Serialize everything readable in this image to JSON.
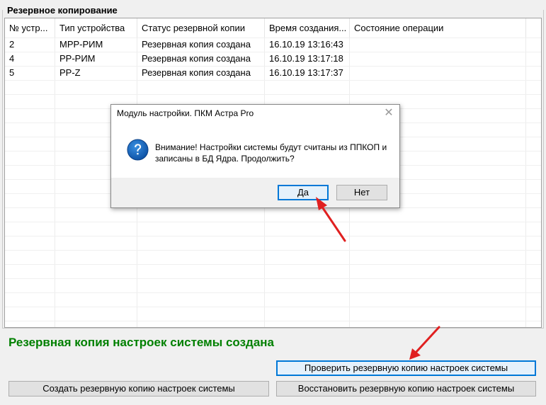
{
  "group_title": "Резервное копирование",
  "columns": [
    "№ устр...",
    "Тип устройства",
    "Статус резервной копии",
    "Время создания...",
    "Состояние операции"
  ],
  "rows": [
    {
      "num": "2",
      "type": "МРР-РИМ",
      "status": "Резервная копия создана",
      "time": "16.10.19 13:16:43",
      "state": ""
    },
    {
      "num": "4",
      "type": "РР-РИМ",
      "status": "Резервная копия создана",
      "time": "16.10.19 13:17:18",
      "state": ""
    },
    {
      "num": "5",
      "type": "РР-Z",
      "status": "Резервная копия создана",
      "time": "16.10.19 13:17:37",
      "state": ""
    }
  ],
  "status_message": "Резервная копия настроек системы создана",
  "status_color": "#008000",
  "buttons": {
    "check": "Проверить резервную копию настроек системы",
    "create": "Создать резервную копию настроек системы",
    "restore": "Восстановить резервную копию настроек системы"
  },
  "dialog": {
    "title": "Модуль настройки. ПКМ Астра Pro",
    "message_line1": "Внимание! Настройки системы будут считаны из ППКОП и",
    "message_line2": "записаны в БД Ядра. Продолжить?",
    "yes": "Да",
    "no": "Нет",
    "icon": "question-icon",
    "close_glyph": "✕"
  },
  "annotation_color": "#e02020"
}
